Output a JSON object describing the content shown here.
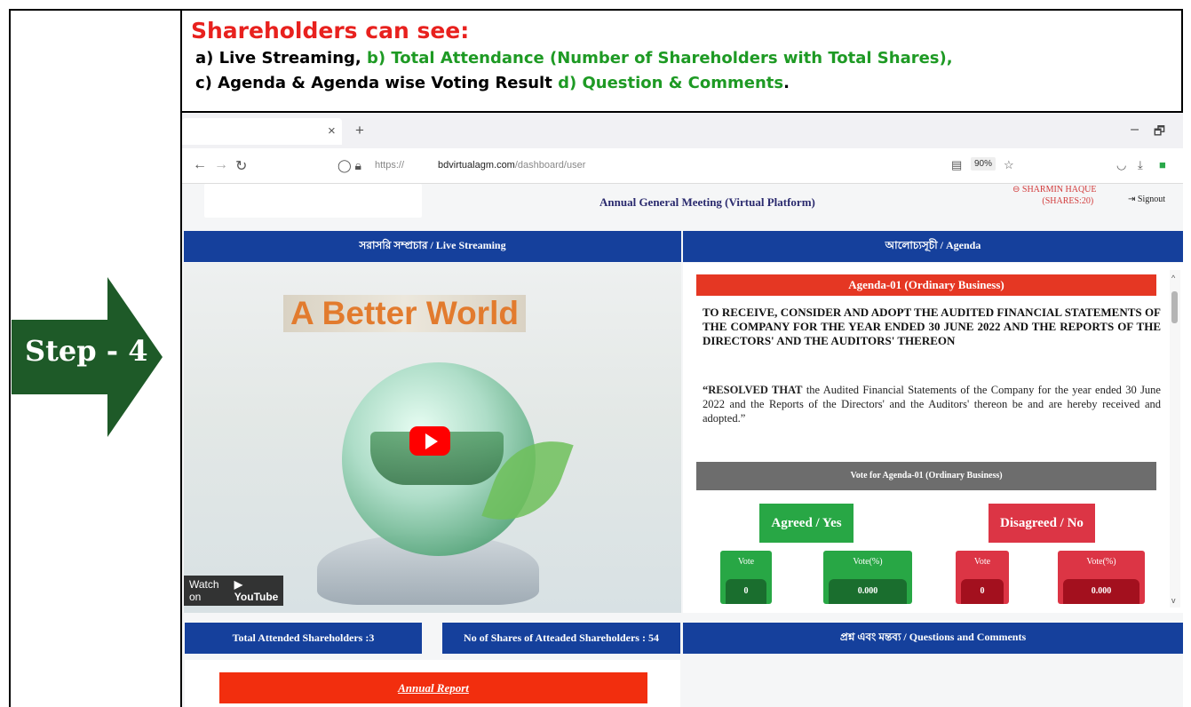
{
  "header": {
    "title": "Shareholders can see:",
    "line1_a": "a) Live Streaming,",
    "line1_b": " b) Total Attendance (Number of Shareholders with Total Shares),",
    "line2_a": "c) Agenda & Agenda wise Voting Result",
    "line2_b": " d) Question & Comments",
    "line2_end": "."
  },
  "step": {
    "label": "Step - 4",
    "color": "#1e5a28"
  },
  "browser": {
    "tab_close": "×",
    "new_tab": "+",
    "minimize": "–",
    "restore": "🗗",
    "url_prefix": "https://",
    "url_host": "bdvirtualagm.com",
    "url_path": "/dashboard/user",
    "zoom": "90%"
  },
  "page": {
    "title": "Annual General Meeting (Virtual Platform)",
    "user_name": "SHARMIN HAQUE",
    "user_shares": "(SHARES:20)",
    "signout": "Signout"
  },
  "panels": {
    "live": "সরাসরি সম্প্রচার / Live Streaming",
    "agenda": "আলোচ্যসূচী / Agenda",
    "attended": "Total Attended Shareholders :3",
    "shares": "No of Shares of Atteaded Shareholders : 54",
    "questions": "প্রশ্ন এবং মন্তব্য / Questions and Comments"
  },
  "video": {
    "title": "A Better World",
    "watch_on": "Watch on",
    "youtube": "YouTube"
  },
  "agenda": {
    "heading": "Agenda-01 (Ordinary Business)",
    "resolution_title": "TO RECEIVE, CONSIDER AND ADOPT THE AUDITED FINANCIAL STATEMENTS OF THE COMPANY FOR THE YEAR ENDED 30 JUNE 2022 AND THE REPORTS OF THE DIRECTORS' AND THE AUDITORS' THEREON",
    "resolved_bold": "“RESOLVED THAT",
    "resolved_text": " the Audited Financial Statements of the Company for the year ended 30 June 2022 and the Reports of the Directors' and the Auditors' thereon be and are hereby received and adopted.”",
    "vote_heading": "Vote for Agenda-01 (Ordinary Business)",
    "yes_label": "Agreed / Yes",
    "no_label": "Disagreed / No",
    "yes_vote_label": "Vote",
    "yes_vote": "0",
    "yes_pct_label": "Vote(%)",
    "yes_pct": "0.000",
    "no_vote_label": "Vote",
    "no_vote": "0",
    "no_pct_label": "Vote(%)",
    "no_pct": "0.000"
  },
  "annual_report": "Annual Report",
  "colors": {
    "header_red": "#e8211e",
    "header_green": "#1e9a24",
    "panel_blue": "#15409c",
    "agenda_red": "#e53723",
    "yes_green": "#28a745",
    "no_red": "#dc3545"
  }
}
